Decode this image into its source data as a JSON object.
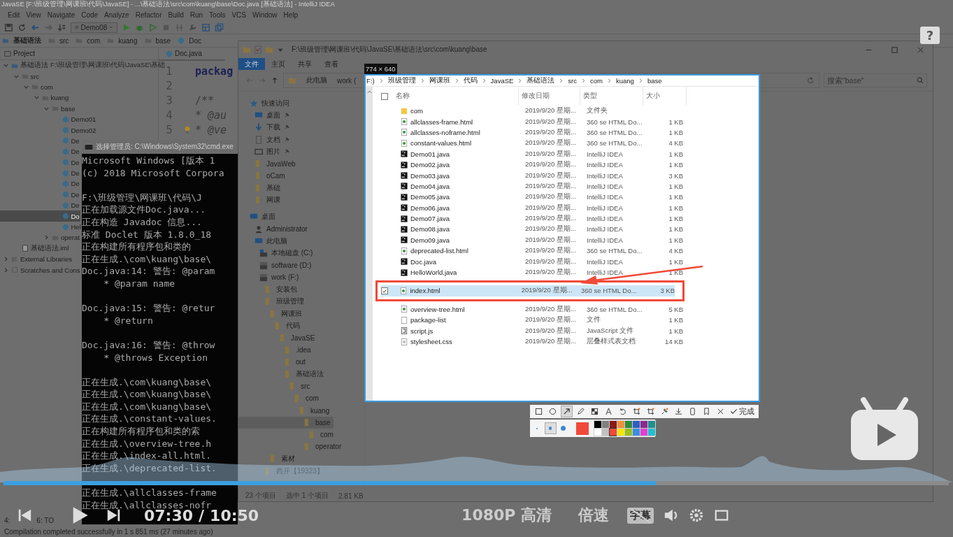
{
  "ide": {
    "title": "JavaSE [F:\\班级管理\\网课班\\代码\\JavaSE] - ...\\基础语法\\src\\com\\kuang\\base\\Doc.java [基础语法] - IntelliJ IDEA",
    "menu": [
      "Edit",
      "View",
      "Navigate",
      "Code",
      "Analyze",
      "Refactor",
      "Build",
      "Run",
      "Tools",
      "VCS",
      "Window",
      "Help"
    ],
    "run_config": "Demo08",
    "breadcrumb": [
      {
        "label": "基础语法",
        "kind": "module"
      },
      {
        "label": "src",
        "kind": "folder"
      },
      {
        "label": "com",
        "kind": "folder"
      },
      {
        "label": "kuang",
        "kind": "folder"
      },
      {
        "label": "base",
        "kind": "folder"
      },
      {
        "label": "Doc",
        "kind": "class"
      }
    ],
    "project_panel": {
      "title": "Project",
      "tree": [
        {
          "label": "基础语法",
          "path": "F:\\班级管理\\网课班\\代码\\JavaSE\\基础",
          "kind": "module",
          "expanded": true,
          "selected": false,
          "children": [
            {
              "label": "src",
              "kind": "folder",
              "expanded": true,
              "selected": false,
              "children": [
                {
                  "label": "com",
                  "kind": "folder",
                  "expanded": true,
                  "selected": false,
                  "children": [
                    {
                      "label": "kuang",
                      "kind": "folder",
                      "expanded": true,
                      "selected": false,
                      "children": [
                        {
                          "label": "base",
                          "kind": "folder",
                          "expanded": true,
                          "selected": false,
                          "children": [
                            {
                              "label": "Demo01",
                              "kind": "class",
                              "selected": false
                            },
                            {
                              "label": "Demo02",
                              "kind": "class",
                              "selected": false
                            },
                            {
                              "label": "De",
                              "kind": "class",
                              "selected": false
                            },
                            {
                              "label": "De",
                              "kind": "class",
                              "selected": false
                            },
                            {
                              "label": "De",
                              "kind": "class",
                              "selected": false
                            },
                            {
                              "label": "De",
                              "kind": "class",
                              "selected": false
                            },
                            {
                              "label": "De",
                              "kind": "class",
                              "selected": false
                            },
                            {
                              "label": "De",
                              "kind": "class",
                              "selected": false
                            },
                            {
                              "label": "De",
                              "kind": "class",
                              "selected": false
                            },
                            {
                              "label": "Do",
                              "kind": "class",
                              "selected": true
                            },
                            {
                              "label": "Hel",
                              "kind": "class",
                              "selected": false
                            }
                          ]
                        },
                        {
                          "label": "operat",
                          "kind": "folder",
                          "expanded": false,
                          "selected": false
                        }
                      ]
                    }
                  ]
                }
              ]
            },
            {
              "label": "基础语法.iml",
              "kind": "file",
              "selected": false
            }
          ]
        },
        {
          "label": "External Libraries",
          "kind": "library",
          "expanded": false,
          "selected": false
        },
        {
          "label": "Scratches and Cons",
          "kind": "scratch",
          "expanded": false,
          "selected": false
        }
      ]
    },
    "editor": {
      "tab": "Doc.java",
      "lines": [
        {
          "number": "1",
          "text": "packag",
          "kind": "keyword",
          "bulb": false
        },
        {
          "number": "2",
          "kind": "blank",
          "bulb": false
        },
        {
          "number": "3",
          "text": "/**",
          "kind": "comment",
          "bulb": false
        },
        {
          "number": "4",
          "text": "* @au",
          "kind": "doc_tag",
          "bulb": false
        },
        {
          "number": "5",
          "text": "* @ve",
          "kind": "doc_tag",
          "bulb": true
        }
      ]
    },
    "tool_tabs": [
      "4:",
      "6: TO"
    ],
    "status": "Compilation completed successfully in 1 s 851 ms (27 minutes ago)"
  },
  "cmd": {
    "title": "选择管理员: C:\\Windows\\System32\\cmd.exe",
    "lines": [
      {
        "kind": "output",
        "text": "Microsoft Windows [版本 1"
      },
      {
        "kind": "output",
        "text": "(c) 2018 Microsoft Corpora"
      },
      {
        "kind": "blank"
      },
      {
        "kind": "output",
        "text": "F:\\班级管理\\网课班\\代码\\J"
      },
      {
        "kind": "output",
        "text": "正在加载源文件Doc.java..."
      },
      {
        "kind": "output",
        "text": "正在构造 Javadoc 信息..."
      },
      {
        "kind": "output",
        "text": "标准 Doclet 版本 1.8.0_18"
      },
      {
        "kind": "output",
        "text": "正在构建所有程序包和类的"
      },
      {
        "kind": "output",
        "text": "正在生成.\\com\\kuang\\base\\"
      },
      {
        "kind": "output",
        "text": "Doc.java:14: 警告: @param"
      },
      {
        "kind": "output",
        "text": "    * @param name"
      },
      {
        "kind": "blank"
      },
      {
        "kind": "output",
        "text": "Doc.java:15: 警告: @retur"
      },
      {
        "kind": "output",
        "text": "    * @return"
      },
      {
        "kind": "blank"
      },
      {
        "kind": "output",
        "text": "Doc.java:16: 警告: @throw"
      },
      {
        "kind": "output",
        "text": "    * @throws Exception"
      },
      {
        "kind": "blank"
      },
      {
        "kind": "output",
        "text": "正在生成.\\com\\kuang\\base\\"
      },
      {
        "kind": "output",
        "text": "正在生成.\\com\\kuang\\base\\"
      },
      {
        "kind": "output",
        "text": "正在生成.\\com\\kuang\\base\\"
      },
      {
        "kind": "output",
        "text": "正在生成.\\constant-values."
      },
      {
        "kind": "output",
        "text": "正在构建所有程序包和类的索"
      },
      {
        "kind": "output",
        "text": "正在生成.\\overview-tree.h"
      },
      {
        "kind": "output",
        "text": "正在生成.\\index-all.html."
      },
      {
        "kind": "output",
        "text": "正在生成.\\deprecated-list."
      },
      {
        "kind": "covered"
      },
      {
        "kind": "output",
        "text": "正在生成.\\allclasses-frame"
      },
      {
        "kind": "output",
        "text": "正在生成.\\allclasses-nofr"
      }
    ]
  },
  "explorer": {
    "address": "F:\\班级管理\\网课班\\代码\\JavaSE\\基础语法\\src\\com\\kuang\\base",
    "ribbon_tabs": [
      {
        "label": "文件",
        "selected": true
      },
      {
        "label": "主页",
        "selected": false
      },
      {
        "label": "共享",
        "selected": false
      },
      {
        "label": "查看",
        "selected": false
      }
    ],
    "breadcrumb": [
      "此电脑",
      "work ("
    ],
    "search": {
      "placeholder": "搜索\"base\""
    },
    "nav": [
      {
        "label": "快速访问",
        "kind": "star",
        "selected": false,
        "children": [
          {
            "label": "桌面",
            "kind": "desktop",
            "pinned": true,
            "selected": false
          },
          {
            "label": "下载",
            "kind": "download",
            "pinned": true,
            "selected": false
          },
          {
            "label": "文档",
            "kind": "document",
            "pinned": true,
            "selected": false
          },
          {
            "label": "图片",
            "kind": "picture",
            "pinned": true,
            "selected": false
          },
          {
            "label": "JavaWeb",
            "kind": "folder",
            "pinned": false,
            "selected": false
          },
          {
            "label": "oCam",
            "kind": "folder",
            "pinned": false,
            "selected": false
          },
          {
            "label": "基础",
            "kind": "folder",
            "pinned": false,
            "selected": false
          },
          {
            "label": "网课",
            "kind": "folder",
            "pinned": false,
            "selected": false
          }
        ]
      },
      {
        "label": "桌面",
        "kind": "desktop",
        "selected": false,
        "children": [
          {
            "label": "Administrator",
            "kind": "user",
            "selected": false
          },
          {
            "label": "此电脑",
            "kind": "computer",
            "selected": false,
            "children": [
              {
                "label": "本地磁盘 (C:)",
                "kind": "system_drive",
                "selected": false
              },
              {
                "label": "software (D:)",
                "kind": "drive",
                "selected": false
              },
              {
                "label": "work (F:)",
                "kind": "drive",
                "selected": false,
                "children": [
                  {
                    "label": "安装包",
                    "kind": "folder",
                    "selected": false
                  },
                  {
                    "label": "班级管理",
                    "kind": "folder",
                    "selected": false,
                    "children": [
                      {
                        "label": "网课班",
                        "kind": "folder",
                        "selected": false,
                        "children": [
                          {
                            "label": "代码",
                            "kind": "folder",
                            "selected": false,
                            "children": [
                              {
                                "label": "JavaSE",
                                "kind": "folder",
                                "selected": false,
                                "children": [
                                  {
                                    "label": ".idea",
                                    "kind": "folder",
                                    "selected": false
                                  },
                                  {
                                    "label": "out",
                                    "kind": "folder",
                                    "selected": false
                                  },
                                  {
                                    "label": "基础语法",
                                    "kind": "folder",
                                    "selected": false,
                                    "children": [
                                      {
                                        "label": "src",
                                        "kind": "folder",
                                        "selected": false,
                                        "children": [
                                          {
                                            "label": "com",
                                            "kind": "folder",
                                            "selected": false,
                                            "children": [
                                              {
                                                "label": "kuang",
                                                "kind": "folder",
                                                "selected": false,
                                                "children": [
                                                  {
                                                    "label": "base",
                                                    "kind": "folder",
                                                    "selected": true,
                                                    "children": [
                                                      {
                                                        "label": "com",
                                                        "kind": "folder",
                                                        "selected": false
                                                      }
                                                    ]
                                                  },
                                                  {
                                                    "label": "operator",
                                                    "kind": "folder",
                                                    "selected": false
                                                  }
                                                ]
                                              }
                                            ]
                                          }
                                        ]
                                      }
                                    ]
                                  }
                                ]
                              }
                            ]
                          }
                        ]
                      },
                      {
                        "label": "素材",
                        "kind": "folder",
                        "selected": false
                      }
                    ]
                  },
                  {
                    "label": "西开【19323】",
                    "kind": "folder",
                    "selected": false
                  }
                ]
              }
            ]
          }
        ]
      }
    ],
    "item_count": "23 个项目",
    "selection": "选中 1 个项目",
    "selection_size": "2.81 KB"
  },
  "capture": {
    "size": "774 × 640",
    "breadcrumb": [
      "F:)",
      "班级管理",
      "网课班",
      "代码",
      "JavaSE",
      "基础语法",
      "src",
      "com",
      "kuang",
      "base"
    ],
    "columns": [
      "名称",
      "修改日期",
      "类型",
      "大小"
    ],
    "select_all_checked": false,
    "rows": [
      {
        "name": "com",
        "date": "2019/9/20 星期...",
        "type": "文件夹",
        "kind": "folder",
        "selected": false
      },
      {
        "name": "allclasses-frame.html",
        "date": "2019/9/20 星期...",
        "type": "360 se HTML Do...",
        "size": "1 KB",
        "kind": "html",
        "selected": false
      },
      {
        "name": "allclasses-noframe.html",
        "date": "2019/9/20 星期...",
        "type": "360 se HTML Do...",
        "size": "1 KB",
        "kind": "html",
        "selected": false
      },
      {
        "name": "constant-values.html",
        "date": "2019/9/20 星期...",
        "type": "360 se HTML Do...",
        "size": "4 KB",
        "kind": "html",
        "selected": false
      },
      {
        "name": "Demo01.java",
        "date": "2019/9/20 星期...",
        "type": "IntelliJ IDEA",
        "size": "1 KB",
        "kind": "java",
        "selected": false
      },
      {
        "name": "Demo02.java",
        "date": "2019/9/20 星期...",
        "type": "IntelliJ IDEA",
        "size": "1 KB",
        "kind": "java",
        "selected": false
      },
      {
        "name": "Demo03.java",
        "date": "2019/9/20 星期...",
        "type": "IntelliJ IDEA",
        "size": "3 KB",
        "kind": "java",
        "selected": false
      },
      {
        "name": "Demo04.java",
        "date": "2019/9/20 星期...",
        "type": "IntelliJ IDEA",
        "size": "1 KB",
        "kind": "java",
        "selected": false
      },
      {
        "name": "Demo05.java",
        "date": "2019/9/20 星期...",
        "type": "IntelliJ IDEA",
        "size": "1 KB",
        "kind": "java",
        "selected": false
      },
      {
        "name": "Demo06.java",
        "date": "2019/9/20 星期...",
        "type": "IntelliJ IDEA",
        "size": "1 KB",
        "kind": "java",
        "selected": false
      },
      {
        "name": "Demo07.java",
        "date": "2019/9/20 星期...",
        "type": "IntelliJ IDEA",
        "size": "1 KB",
        "kind": "java",
        "selected": false
      },
      {
        "name": "Demo08.java",
        "date": "2019/9/20 星期...",
        "type": "IntelliJ IDEA",
        "size": "1 KB",
        "kind": "java",
        "selected": false
      },
      {
        "name": "Demo09.java",
        "date": "2019/9/20 星期...",
        "type": "IntelliJ IDEA",
        "size": "1 KB",
        "kind": "java",
        "selected": false
      },
      {
        "name": "deprecated-list.html",
        "date": "2019/9/20 星期...",
        "type": "360 se HTML Do...",
        "size": "4 KB",
        "kind": "html",
        "selected": false
      },
      {
        "name": "Doc.java",
        "date": "2019/9/20 星期...",
        "type": "IntelliJ IDEA",
        "size": "1 KB",
        "kind": "java",
        "selected": false
      },
      {
        "name": "HelloWorld.java",
        "date": "2019/9/20 星期...",
        "type": "IntelliJ IDEA",
        "size": "1 KB",
        "kind": "java",
        "selected": false
      },
      {
        "name": "index.html",
        "date": "2019/9/20 星期...",
        "type": "360 se HTML Do...",
        "size": "3 KB",
        "kind": "html",
        "selected": true
      },
      {
        "name": "overview-tree.html",
        "date": "2019/9/20 星期...",
        "type": "360 se HTML Do...",
        "size": "5 KB",
        "kind": "html",
        "selected": false
      },
      {
        "name": "package-list",
        "date": "2019/9/20 星期...",
        "type": "文件",
        "size": "1 KB",
        "kind": "file",
        "selected": false
      },
      {
        "name": "script.js",
        "date": "2019/9/20 星期...",
        "type": "JavaScript 文件",
        "size": "1 KB",
        "kind": "js",
        "selected": false
      },
      {
        "name": "stylesheet.css",
        "date": "2019/9/20 星期...",
        "type": "层叠样式表文档",
        "size": "14 KB",
        "kind": "css",
        "selected": false
      }
    ],
    "tools": [
      {
        "kind": "rect",
        "selected": false
      },
      {
        "kind": "ellipse",
        "selected": false
      },
      {
        "kind": "arrow",
        "selected": true
      },
      {
        "kind": "pen",
        "selected": false
      },
      {
        "kind": "mosaic",
        "selected": false
      },
      {
        "kind": "text",
        "selected": false
      },
      {
        "kind": "undo",
        "selected": false
      },
      {
        "kind": "crop",
        "selected": false
      },
      {
        "kind": "crop",
        "selected": false
      },
      {
        "kind": "pin",
        "selected": false
      },
      {
        "kind": "download",
        "selected": false
      },
      {
        "kind": "phone",
        "selected": false
      },
      {
        "kind": "bookmark",
        "selected": false
      },
      {
        "kind": "close",
        "selected": false
      }
    ],
    "done": "完成",
    "brush_sizes": [
      {
        "selected": false
      },
      {
        "selected": true
      },
      {
        "selected": false
      }
    ],
    "palette": [
      {
        "color": "#000000",
        "selected": false
      },
      {
        "color": "#808080",
        "selected": false
      },
      {
        "color": "#8b1a1a",
        "selected": false
      },
      {
        "color": "#f0903a",
        "selected": false
      },
      {
        "color": "#2e8b3e",
        "selected": false
      },
      {
        "color": "#2f5fc0",
        "selected": false
      },
      {
        "color": "#8b2a90",
        "selected": false
      },
      {
        "color": "#1f9090",
        "selected": false
      },
      {
        "color": "#ffffff",
        "selected": false
      },
      {
        "color": "#c0c0c0",
        "selected": false
      },
      {
        "color": "#f04a3a",
        "selected": true
      },
      {
        "color": "#f5e600",
        "selected": false
      },
      {
        "color": "#9ac020",
        "selected": false
      },
      {
        "color": "#3a8ee0",
        "selected": false
      },
      {
        "color": "#e040d0",
        "selected": false
      },
      {
        "color": "#20c0d0",
        "selected": false
      }
    ]
  },
  "player": {
    "time": "07:30",
    "separator": "/",
    "duration": "10:50",
    "progress": {
      "level": 0.69
    },
    "quality": "1080P 高清",
    "speed": "倍速",
    "subtitle": "字幕",
    "subtitles_on": false
  },
  "help": "?"
}
